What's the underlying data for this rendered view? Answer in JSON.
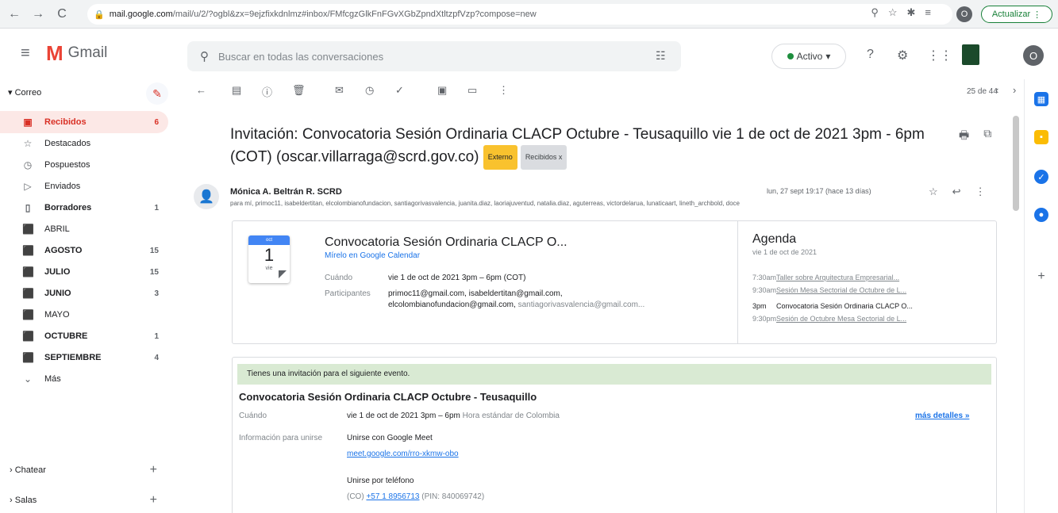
{
  "browser": {
    "url_domain": "mail.google.com",
    "url_path": "/mail/u/2/?ogbl&zx=9ejzfixkdnlmz#inbox/FMfcgzGlkFnFGvXGbZpndXtltzpfVzp?compose=new",
    "profile_initial": "O",
    "update_label": "Actualizar"
  },
  "header": {
    "app_name": "Gmail",
    "search_placeholder": "Buscar en todas las conversaciones",
    "status_label": "Activo",
    "avatar_initial": "O"
  },
  "sidebar": {
    "section": "Correo",
    "items": [
      {
        "label": "Recibidos",
        "count": "6"
      },
      {
        "label": "Destacados",
        "count": ""
      },
      {
        "label": "Pospuestos",
        "count": ""
      },
      {
        "label": "Enviados",
        "count": ""
      },
      {
        "label": "Borradores",
        "count": "1"
      },
      {
        "label": "ABRIL",
        "count": ""
      },
      {
        "label": "AGOSTO",
        "count": "15"
      },
      {
        "label": "JULIO",
        "count": "15"
      },
      {
        "label": "JUNIO",
        "count": "3"
      },
      {
        "label": "MAYO",
        "count": ""
      },
      {
        "label": "OCTUBRE",
        "count": "1"
      },
      {
        "label": "SEPTIEMBRE",
        "count": "4"
      },
      {
        "label": "Más",
        "count": ""
      }
    ],
    "chat_label": "Chatear",
    "rooms_label": "Salas"
  },
  "toolbar": {
    "pager": "25 de 44"
  },
  "email": {
    "subject": "Invitación: Convocatoria Sesión Ordinaria CLACP Octubre - Teusaquillo vie 1 de oct de 2021 3pm - 6pm (COT) (oscar.villarraga@scrd.gov.co)",
    "badge_external": "Externo",
    "badge_label": "Recibidos x",
    "sender": "Mónica A. Beltrán R. SCRD",
    "to": "para mí, primoc11, isabeldertitan, elcolombianofundacion, santiagorivasvalencia, juanita.diaz, laoriajuventud, natalia.diaz, aguterreas, victordelarua, lunaticaart, lineth_archbold, doce",
    "date": "lun, 27 sept 19:17 (hace 13 días)"
  },
  "invite": {
    "cal_month": "oct",
    "cal_day": "1",
    "cal_weekday": "vie",
    "title": "Convocatoria Sesión Ordinaria CLACP O...",
    "gcal_link": "Mírelo en Google Calendar",
    "when_label": "Cuándo",
    "when_value": "vie 1 de oct de 2021 3pm – 6pm (COT)",
    "guests_label": "Participantes",
    "guests_line1": "primoc11@gmail.com, isabeldertitan@gmail.com,",
    "guests_line2_bold": "elcolombianofundacion@gmail.com,",
    "guests_line2_rest": "santiagorivasvalencia@gmail.com..."
  },
  "agenda": {
    "title": "Agenda",
    "date": "vie 1 de oct de 2021",
    "rows": [
      {
        "time": "7:30am",
        "event": "Taller sobre Arquitectura Empresarial..."
      },
      {
        "time": "9:30am",
        "event": "Sesión Mesa Sectorial de Octubre de L..."
      },
      {
        "time": "3pm",
        "event": "Convocatoria Sesión Ordinaria CLACP O..."
      },
      {
        "time": "9:30pm",
        "event": "Sesión de Octubre Mesa Sectorial de L..."
      }
    ]
  },
  "details": {
    "notice": "Tienes una invitación para el siguiente evento.",
    "title": "Convocatoria Sesión Ordinaria CLACP Octubre - Teusaquillo",
    "when_label": "Cuándo",
    "when_value": "vie 1 de oct de 2021 3pm – 6pm",
    "when_tz": "Hora estándar de Colombia",
    "more_details": "más detalles »",
    "join_label": "Información para unirse",
    "meet_label": "Unirse con Google Meet",
    "meet_link": "meet.google.com/rro-xkmw-obo",
    "phone_label": "Unirse por teléfono",
    "phone_cc": "(CO)",
    "phone_number": "+57 1 8956713",
    "phone_pin": "(PIN: 840069742)"
  }
}
